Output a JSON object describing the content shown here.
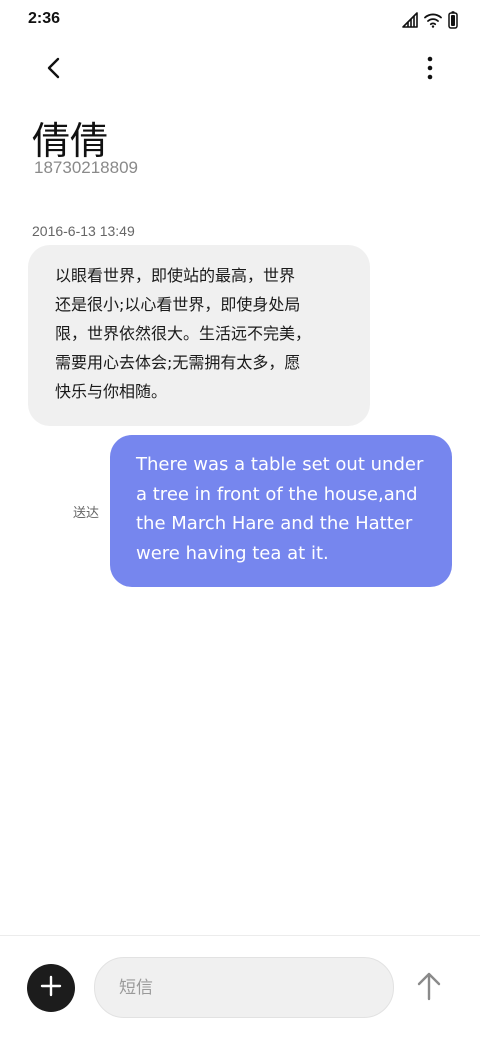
{
  "status_bar": {
    "time": "2:36",
    "icons": [
      "signal-icon",
      "wifi-icon",
      "battery-icon"
    ]
  },
  "header": {
    "back_icon": "chevron-left-icon",
    "more_icon": "more-vertical-icon"
  },
  "contact": {
    "name": "倩倩",
    "number": "18730218809"
  },
  "conversation": {
    "timestamp": "2016-6-13 13:49",
    "received": {
      "lines": [
        "以眼看世界，即使站的最高，世界",
        "还是很小;以心看世界，即使身处局",
        "限，世界依然很大。生活远不完美，",
        "需要用心去体会;无需拥有太多，愿",
        "快乐与你相随。"
      ]
    },
    "sent": {
      "lines": [
        "There was a table set out under",
        "a tree in front of the house,and",
        "the March Hare and the Hatter",
        "were having tea at it."
      ],
      "status": "送达"
    }
  },
  "composer": {
    "placeholder": "短信",
    "value": "",
    "add_icon": "plus-icon",
    "send_icon": "arrow-up-icon"
  },
  "colors": {
    "sent_bubble": "#7686ee",
    "received_bubble": "#f0f0f0",
    "add_button": "#1c1c1c"
  }
}
